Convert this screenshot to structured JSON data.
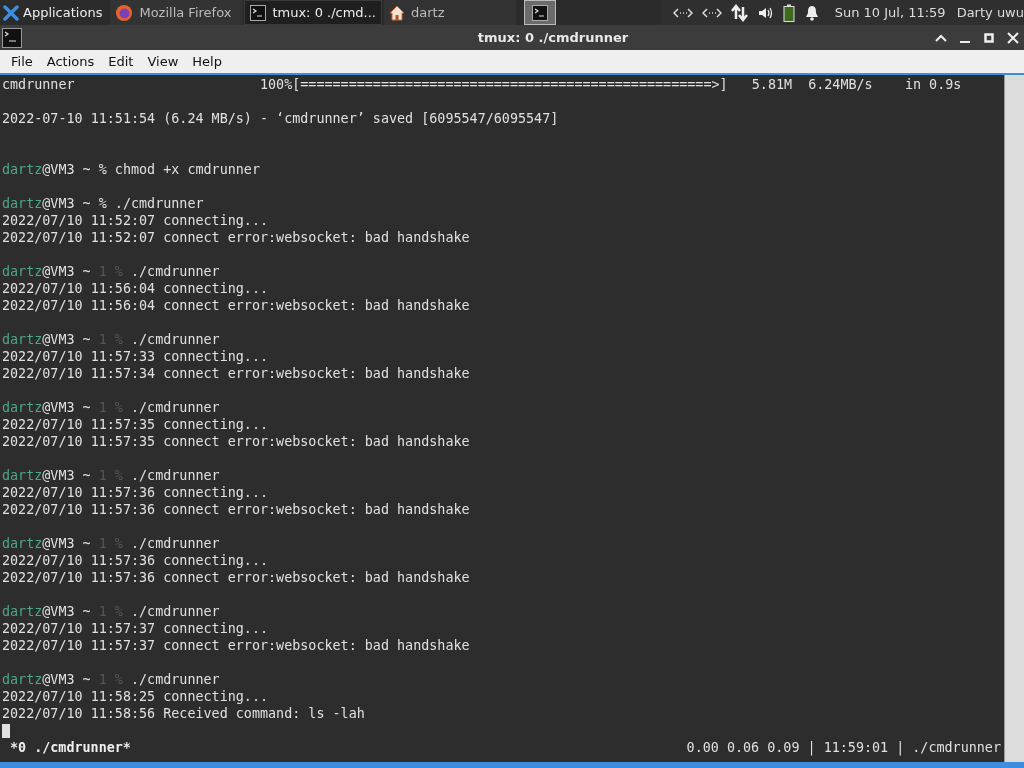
{
  "panel": {
    "menu": {
      "label": "Applications"
    },
    "tasks": [
      {
        "label": "Mozilla Firefox",
        "kind": "browser",
        "selected": false
      },
      {
        "label": "tmux: 0 ./cmd...",
        "kind": "terminal",
        "selected": true
      },
      {
        "label": "dartz",
        "kind": "folder",
        "selected": false
      }
    ],
    "clock": "Sun 10 Jul, 11:59",
    "user": "Darty uwu"
  },
  "window": {
    "title": "tmux: 0 ./cmdrunner"
  },
  "menu": [
    "File",
    "Actions",
    "Edit",
    "View",
    "Help"
  ],
  "terminal": {
    "lines": [
      {
        "kind": "text",
        "text": "cmdrunner                       100%[===================================================>]   5.81M  6.24MB/s    in 0.9s"
      },
      {
        "kind": "blank"
      },
      {
        "kind": "text",
        "text": "2022-07-10 11:51:54 (6.24 MB/s) - ‘cmdrunner’ saved [6095547/6095547]"
      },
      {
        "kind": "blank"
      },
      {
        "kind": "blank"
      },
      {
        "kind": "prompt",
        "user": "dartz",
        "host": "@VM3",
        "dir": "~",
        "symbol": "%",
        "command": "chmod +x cmdrunner"
      },
      {
        "kind": "blank"
      },
      {
        "kind": "prompt",
        "user": "dartz",
        "host": "@VM3",
        "dir": "~",
        "symbol": "%",
        "command": "./cmdrunner"
      },
      {
        "kind": "text",
        "text": "2022/07/10 11:52:07 connecting..."
      },
      {
        "kind": "text",
        "text": "2022/07/10 11:52:07 connect error:websocket: bad handshake"
      },
      {
        "kind": "blank"
      },
      {
        "kind": "prompt",
        "user": "dartz",
        "host": "@VM3",
        "dir": "~",
        "status": "1",
        "symbol": "%",
        "command": "./cmdrunner"
      },
      {
        "kind": "text",
        "text": "2022/07/10 11:56:04 connecting..."
      },
      {
        "kind": "text",
        "text": "2022/07/10 11:56:04 connect error:websocket: bad handshake"
      },
      {
        "kind": "blank"
      },
      {
        "kind": "prompt",
        "user": "dartz",
        "host": "@VM3",
        "dir": "~",
        "status": "1",
        "symbol": "%",
        "command": "./cmdrunner"
      },
      {
        "kind": "text",
        "text": "2022/07/10 11:57:33 connecting..."
      },
      {
        "kind": "text",
        "text": "2022/07/10 11:57:34 connect error:websocket: bad handshake"
      },
      {
        "kind": "blank"
      },
      {
        "kind": "prompt",
        "user": "dartz",
        "host": "@VM3",
        "dir": "~",
        "status": "1",
        "symbol": "%",
        "command": "./cmdrunner"
      },
      {
        "kind": "text",
        "text": "2022/07/10 11:57:35 connecting..."
      },
      {
        "kind": "text",
        "text": "2022/07/10 11:57:35 connect error:websocket: bad handshake"
      },
      {
        "kind": "blank"
      },
      {
        "kind": "prompt",
        "user": "dartz",
        "host": "@VM3",
        "dir": "~",
        "status": "1",
        "symbol": "%",
        "command": "./cmdrunner"
      },
      {
        "kind": "text",
        "text": "2022/07/10 11:57:36 connecting..."
      },
      {
        "kind": "text",
        "text": "2022/07/10 11:57:36 connect error:websocket: bad handshake"
      },
      {
        "kind": "blank"
      },
      {
        "kind": "prompt",
        "user": "dartz",
        "host": "@VM3",
        "dir": "~",
        "status": "1",
        "symbol": "%",
        "command": "./cmdrunner"
      },
      {
        "kind": "text",
        "text": "2022/07/10 11:57:36 connecting..."
      },
      {
        "kind": "text",
        "text": "2022/07/10 11:57:36 connect error:websocket: bad handshake"
      },
      {
        "kind": "blank"
      },
      {
        "kind": "prompt",
        "user": "dartz",
        "host": "@VM3",
        "dir": "~",
        "status": "1",
        "symbol": "%",
        "command": "./cmdrunner"
      },
      {
        "kind": "text",
        "text": "2022/07/10 11:57:37 connecting..."
      },
      {
        "kind": "text",
        "text": "2022/07/10 11:57:37 connect error:websocket: bad handshake"
      },
      {
        "kind": "blank"
      },
      {
        "kind": "prompt",
        "user": "dartz",
        "host": "@VM3",
        "dir": "~",
        "status": "1",
        "symbol": "%",
        "command": "./cmdrunner"
      },
      {
        "kind": "text",
        "text": "2022/07/10 11:58:25 connecting..."
      },
      {
        "kind": "text",
        "text": "2022/07/10 11:58:56 Received command: ls -lah"
      },
      {
        "kind": "cursor"
      }
    ]
  },
  "tmux_status": {
    "window": "*0 ./cmdrunner*",
    "info": "0.00 0.06 0.09 | 11:59:01 | ./cmdrunner"
  }
}
